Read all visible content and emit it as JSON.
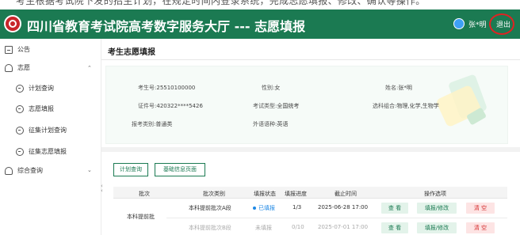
{
  "top_strip": {
    "text": "考生根据考试院下发的招生计划，在规定时间内登录系统，完成志愿填报、修改、确认等操作。"
  },
  "header": {
    "title": "四川省教育考试院高考数字服务大厅 --- 志愿填报",
    "user_name": "张*明",
    "logout_label": "退出",
    "brand_color": "#1b7a52",
    "highlight_color": "#e02222"
  },
  "sidebar": {
    "notice": "公告",
    "volunteer": "志愿",
    "sub_items": [
      "计划查询",
      "志愿填报",
      "征集计划查询",
      "征集志愿填报"
    ],
    "composite": "综合查询"
  },
  "page_title": "考生志愿填报",
  "info": {
    "exam_no_label": "考生号:",
    "exam_no": "25510100000",
    "gender_label": "性别:",
    "gender": "女",
    "name_label": "姓名:",
    "name": "张*明",
    "id_label": "证件号:",
    "id_value": "420322****5426",
    "exam_type_label": "考试类型:",
    "exam_type": "全国统考",
    "subjects_label": "选科组合:",
    "subjects": "物理,化学,生物学",
    "category_label": "报考类别:",
    "category": "普通类",
    "language_label": "外语语种:",
    "language": "英语"
  },
  "tabs": [
    "计划查询",
    "基础信息页面"
  ],
  "table": {
    "headers": [
      "批次",
      "批次类别",
      "填报状态",
      "填报进度",
      "截止时间",
      "操作选项"
    ],
    "batch": "本科提前批",
    "rows": [
      {
        "category": "本科提前批次A段",
        "status": "已填报",
        "progress": "1/3",
        "deadline": "2025-06-28 17:00"
      },
      {
        "category": "本科提前批次B段",
        "status": "未填报",
        "progress": "0/10",
        "deadline": "2025-07-01 17:00"
      }
    ],
    "ops": {
      "view": "查 看",
      "edit": "填报/修改",
      "clear": "清 空"
    }
  }
}
